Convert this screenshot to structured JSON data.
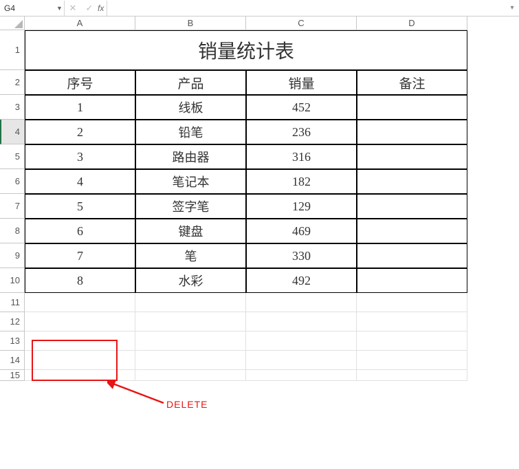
{
  "formula_bar": {
    "name_box": "G4",
    "cancel": "✕",
    "confirm": "✓",
    "fx": "fx",
    "formula": ""
  },
  "columns": [
    "A",
    "B",
    "C",
    "D"
  ],
  "rows": [
    "1",
    "2",
    "3",
    "4",
    "5",
    "6",
    "7",
    "8",
    "9",
    "10",
    "11",
    "12",
    "13",
    "14",
    "15"
  ],
  "title": "销量统计表",
  "headers": {
    "seq": "序号",
    "product": "产品",
    "sales": "销量",
    "notes": "备注"
  },
  "data": [
    {
      "seq": "1",
      "product": "线板",
      "sales": "452",
      "notes": ""
    },
    {
      "seq": "2",
      "product": "铅笔",
      "sales": "236",
      "notes": ""
    },
    {
      "seq": "3",
      "product": "路由器",
      "sales": "316",
      "notes": ""
    },
    {
      "seq": "4",
      "product": "笔记本",
      "sales": "182",
      "notes": ""
    },
    {
      "seq": "5",
      "product": "签字笔",
      "sales": "129",
      "notes": ""
    },
    {
      "seq": "6",
      "product": "键盘",
      "sales": "469",
      "notes": ""
    },
    {
      "seq": "7",
      "product": "笔",
      "sales": "330",
      "notes": ""
    },
    {
      "seq": "8",
      "product": "水彩",
      "sales": "492",
      "notes": ""
    }
  ],
  "annotation": {
    "text": "DELETE"
  }
}
